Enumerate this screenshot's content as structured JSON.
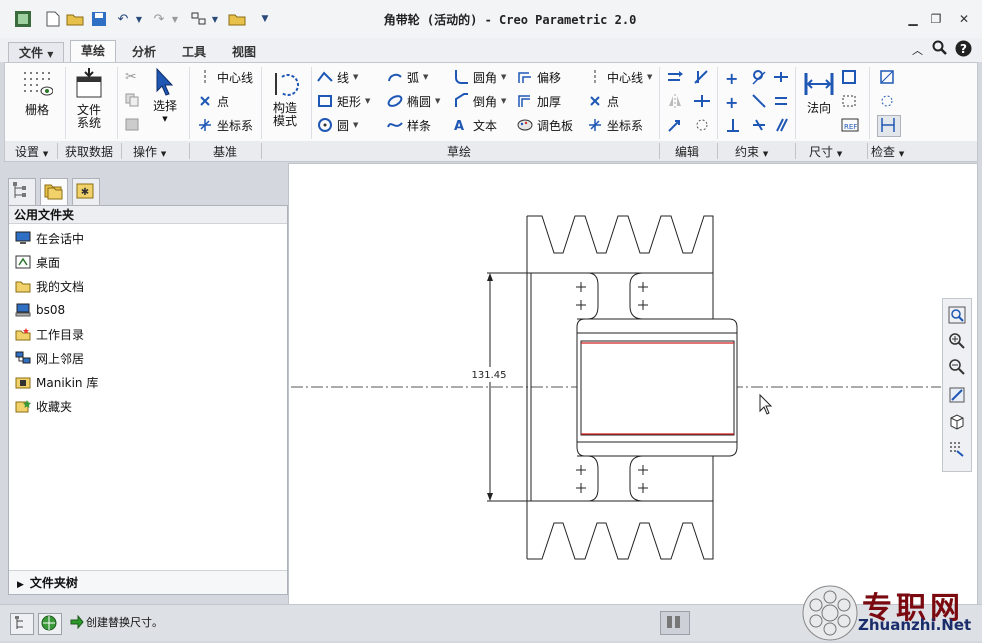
{
  "window": {
    "title": "角带轮 (活动的) - Creo Parametric 2.0",
    "controls": [
      "minimize",
      "restore",
      "close"
    ]
  },
  "tabs": [
    {
      "label": "文件",
      "dropdown": true
    },
    {
      "label": "草绘",
      "active": true
    },
    {
      "label": "分析"
    },
    {
      "label": "工具"
    },
    {
      "label": "视图"
    }
  ],
  "ribbon": {
    "setup": {
      "grid": "栅格"
    },
    "get_data": {
      "file_system": "文件\n系统"
    },
    "operations": {
      "select": "选择"
    },
    "datum": {
      "centerline": "中心线",
      "point": "点",
      "coord_sys": "坐标系"
    },
    "construction_mode": "构造\n模式",
    "sketch": {
      "line": "线",
      "rectangle": "矩形",
      "circle": "圆",
      "arc": "弧",
      "ellipse": "椭圆",
      "spline": "样条",
      "fillet": "圆角",
      "chamfer": "倒角",
      "text": "文本",
      "offset": "偏移",
      "thicken": "加厚",
      "palette": "调色板",
      "centerline": "中心线",
      "point": "点",
      "coord_sys": "坐标系"
    },
    "dimension": {
      "normal": "法向"
    }
  },
  "groups": [
    "设置",
    "获取数据",
    "操作",
    "基准",
    "草绘",
    "编辑",
    "约束",
    "尺寸",
    "检查"
  ],
  "left_panel": {
    "header": "公用文件夹",
    "items": [
      "在会话中",
      "桌面",
      "我的文档",
      "bs08",
      "工作目录",
      "网上邻居",
      "Manikin 库",
      "收藏夹"
    ],
    "footer": "文件夹树"
  },
  "drawing": {
    "dimension_label": "131.45"
  },
  "status": {
    "message": "创建替换尺寸。"
  },
  "watermark": {
    "cn": "专职网",
    "en": "Zhuanzhi.Net"
  },
  "colors": {
    "accent_blue": "#1f57b5",
    "profile_red": "#d22020",
    "watermark_red": "#7a0a10"
  }
}
